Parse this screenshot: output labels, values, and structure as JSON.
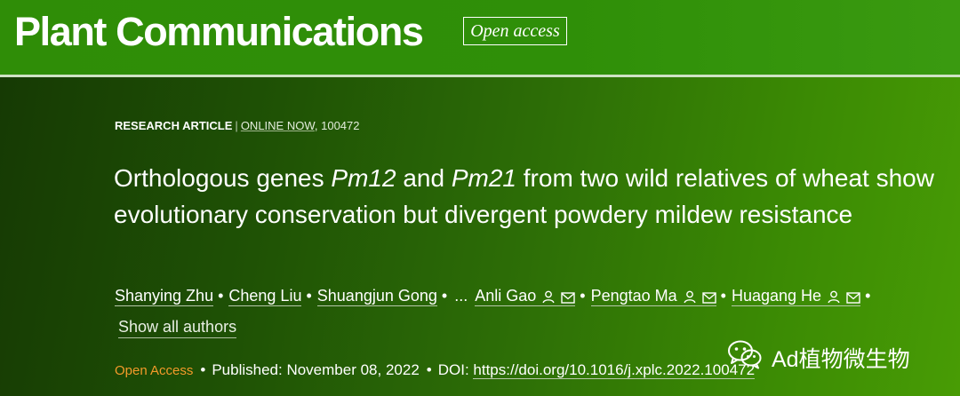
{
  "journal": {
    "name": "Plant Communications",
    "badge": "Open access"
  },
  "article": {
    "type": "RESEARCH ARTICLE",
    "separator": "|",
    "status": "ONLINE NOW",
    "article_number": ", 100472",
    "title_parts": [
      "Orthologous genes ",
      "Pm12",
      " and ",
      "Pm21",
      " from two wild relatives of wheat show evolutionary conservation but divergent powdery mildew resistance"
    ]
  },
  "authors": [
    {
      "name": "Shanying Zhu"
    },
    {
      "name": "Cheng Liu"
    },
    {
      "name": "Shuangjun Gong"
    },
    {
      "name": "Anli Gao"
    },
    {
      "name": "Pengtao Ma"
    },
    {
      "name": "Huagang He"
    }
  ],
  "authors_ellipsis": "...",
  "show_all_authors": "Show all authors",
  "publication": {
    "access": "Open Access",
    "published": "Published: November 08, 2022",
    "doi_label": "DOI: ",
    "doi_url": "https://doi.org/10.1016/j.xplc.2022.100472"
  },
  "watermark": {
    "text": "Ad植物微生物",
    "icon": "wechat-icon"
  },
  "colors": {
    "header_green": "#2f8d07",
    "hero_dark": "#163a04",
    "hero_light": "#489c05",
    "open_access_orange": "#f39a2a"
  }
}
